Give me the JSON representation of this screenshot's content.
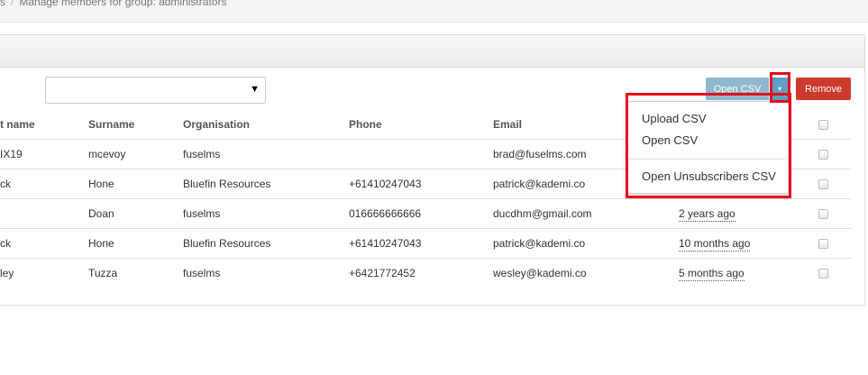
{
  "breadcrumb": {
    "prev": "s",
    "current": "Manage members for group: administrators"
  },
  "toolbar": {
    "open_csv_label": "Open CSV",
    "remove_label": "Remove",
    "caret_glyph": "▾"
  },
  "filter_select": {
    "value": "",
    "caret": "▼"
  },
  "csv_menu": {
    "items": [
      {
        "label": "Upload CSV"
      },
      {
        "label": "Open CSV"
      },
      {
        "label": "Open Unsubscribers CSV"
      }
    ]
  },
  "table": {
    "headers": [
      "t name",
      "Surname",
      "Organisation",
      "Phone",
      "Email"
    ],
    "rows": [
      {
        "first": "IX19",
        "surname": "mcevoy",
        "org": "fuselms",
        "phone": "",
        "email": "brad@fuselms.com",
        "ago": ""
      },
      {
        "first": "ck",
        "surname": "Hone",
        "org": "Bluefin Resources",
        "phone": "+61410247043",
        "email": "patrick@kademi.co",
        "ago": ""
      },
      {
        "first": "",
        "surname": "Doan",
        "org": "fuselms",
        "phone": "016666666666",
        "email": "ducdhm@gmail.com",
        "ago": "2 years ago"
      },
      {
        "first": "ck",
        "surname": "Hone",
        "org": "Bluefin Resources",
        "phone": "+61410247043",
        "email": "patrick@kademi.co",
        "ago": "10 months ago"
      },
      {
        "first": "ley",
        "surname": "Tuzza",
        "org": "fuselms",
        "phone": "+6421772452",
        "email": "wesley@kademi.co",
        "ago": "5 months ago"
      }
    ]
  },
  "colors": {
    "open_btn": "#8fb7cf",
    "caret_btn": "#5e9fc3",
    "remove_btn": "#cc3a2e",
    "highlight": "#e8091c"
  }
}
